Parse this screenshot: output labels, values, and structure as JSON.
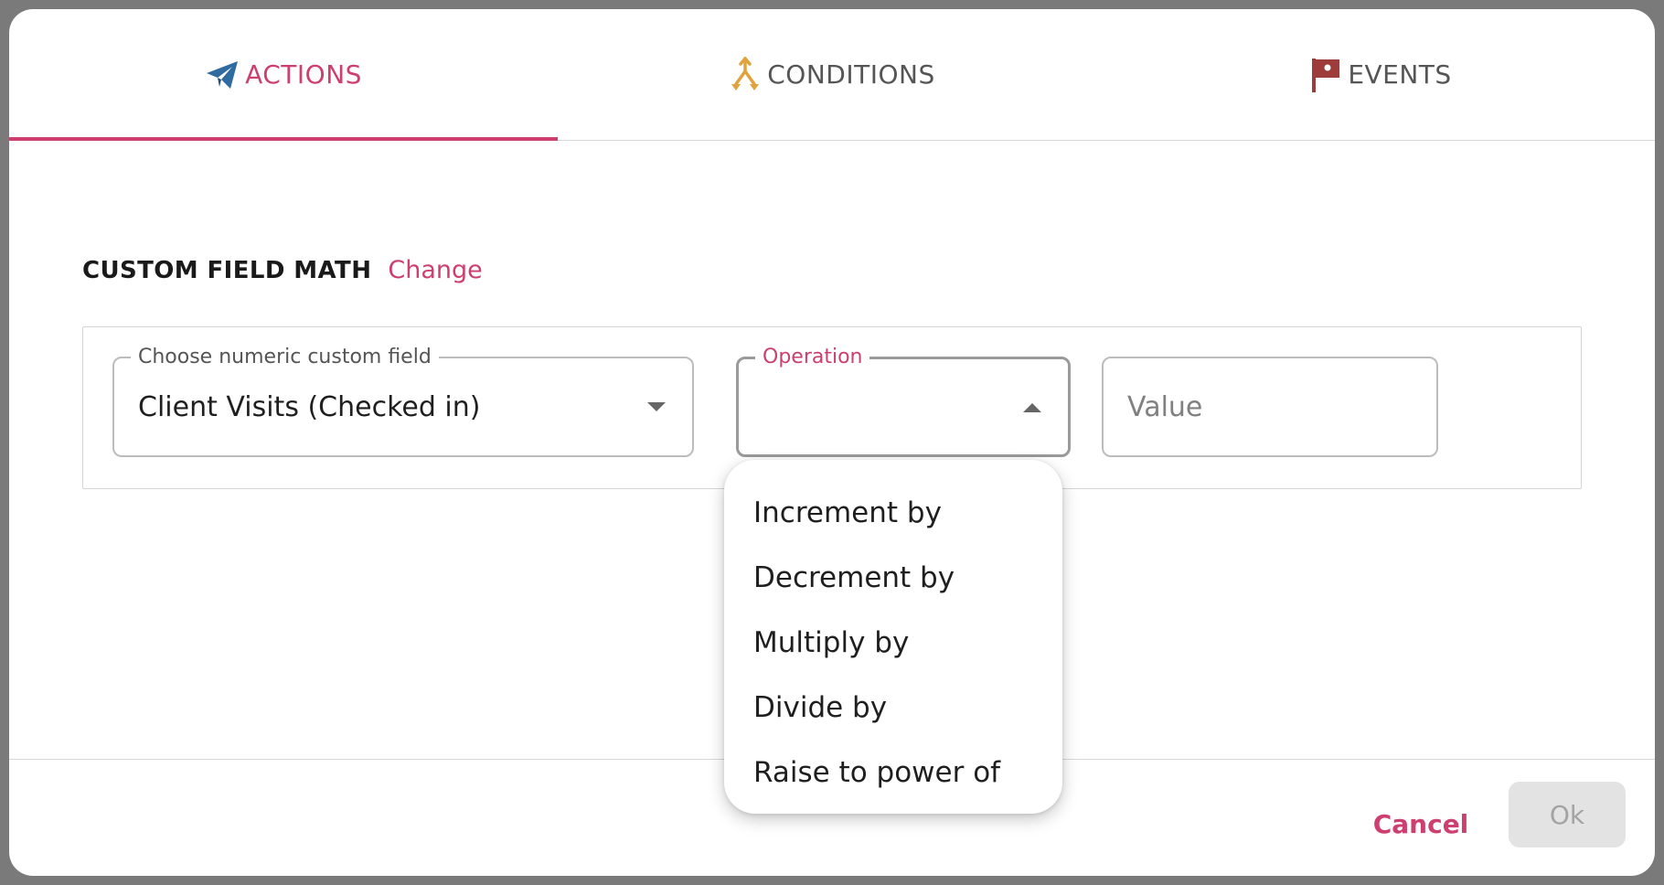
{
  "tabs": [
    {
      "label": "ACTIONS",
      "icon": "paper-plane-icon",
      "color": "#2f6aa0",
      "active": true
    },
    {
      "label": "CONDITIONS",
      "icon": "split-arrows-icon",
      "color": "#e0a23a",
      "active": false
    },
    {
      "label": "EVENTS",
      "icon": "flag-icon",
      "color": "#9e3b3b",
      "active": false
    }
  ],
  "section": {
    "title": "CUSTOM FIELD MATH",
    "change_label": "Change"
  },
  "fields": {
    "custom_field": {
      "label": "Choose numeric custom field",
      "value": "Client Visits (Checked in)"
    },
    "operation": {
      "label": "Operation",
      "value": ""
    },
    "value": {
      "placeholder": "Value"
    }
  },
  "operation_menu": [
    "Increment by",
    "Decrement by",
    "Multiply by",
    "Divide by",
    "Raise to power of"
  ],
  "footer": {
    "cancel_label": "Cancel",
    "ok_label": "Ok"
  },
  "colors": {
    "accent": "#cc3f6e",
    "disabled_bg": "#e3e3e3",
    "disabled_text": "#a3a3a3"
  }
}
